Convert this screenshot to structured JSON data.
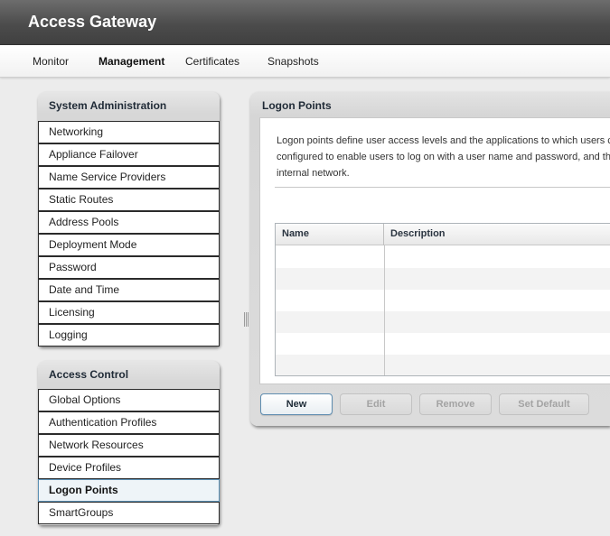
{
  "app": {
    "title": "Access Gateway"
  },
  "nav": {
    "items": [
      {
        "label": "Monitor"
      },
      {
        "label": "Management"
      },
      {
        "label": "Certificates"
      },
      {
        "label": "Snapshots"
      }
    ],
    "active": "Management"
  },
  "system_admin": {
    "title": "System Administration",
    "items": [
      {
        "label": "Networking"
      },
      {
        "label": "Appliance Failover"
      },
      {
        "label": "Name Service Providers"
      },
      {
        "label": "Static Routes"
      },
      {
        "label": "Address Pools"
      },
      {
        "label": "Deployment Mode"
      },
      {
        "label": "Password"
      },
      {
        "label": "Date and Time"
      },
      {
        "label": "Licensing"
      },
      {
        "label": "Logging"
      }
    ]
  },
  "access_control": {
    "title": "Access Control",
    "items": [
      {
        "label": "Global Options"
      },
      {
        "label": "Authentication Profiles"
      },
      {
        "label": "Network Resources"
      },
      {
        "label": "Device Profiles"
      },
      {
        "label": "Logon Points"
      },
      {
        "label": "SmartGroups"
      }
    ],
    "selected": "Logon Points"
  },
  "main": {
    "title": "Logon Points",
    "description_lines": [
      "Logon points define user access levels and the applications to which users c",
      "configured to enable users to log on with a user name and password, and th",
      "internal network."
    ],
    "table": {
      "columns": [
        "Name",
        "Description"
      ],
      "rows": []
    },
    "buttons": {
      "new": "New",
      "edit": "Edit",
      "remove": "Remove",
      "set_default": "Set Default"
    }
  },
  "colors": {
    "header_bg": "#4c4c4c",
    "selected_border": "#5b8fb3",
    "primary_button_border": "#5f8db0"
  }
}
